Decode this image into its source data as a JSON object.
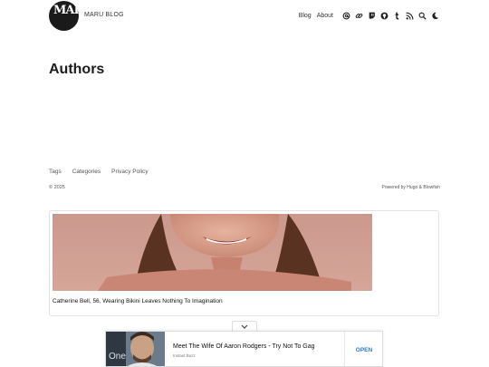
{
  "header": {
    "logo_text": "MARU",
    "site_title": "MARU BLOG",
    "nav": [
      {
        "label": "Blog"
      },
      {
        "label": "About"
      }
    ],
    "icons": [
      "at-icon",
      "link-icon",
      "twitch-icon",
      "github-icon",
      "tumblr-icon",
      "rss-icon",
      "search-icon",
      "moon-icon"
    ]
  },
  "main": {
    "title": "Authors"
  },
  "footer": {
    "links": [
      {
        "label": "Tags"
      },
      {
        "label": "Categories"
      },
      {
        "label": "Privacy Policy"
      }
    ],
    "copyright": "© 2025",
    "powered": "Powered by Hugo & Blowfish"
  },
  "ad": {
    "badge": "▷",
    "caption": "Catherine Bell, 56, Wearing Bikini Leaves Nothing To Imagination"
  },
  "bottom_ad": {
    "thumb_text": "One",
    "headline": "Meet The Wife Of Aaron Rodgers - Try Not To Gag",
    "source": "Instant Buzz",
    "cta": "OPEN"
  },
  "colors": {
    "accent": "#2a7ad2",
    "text": "#222222"
  }
}
